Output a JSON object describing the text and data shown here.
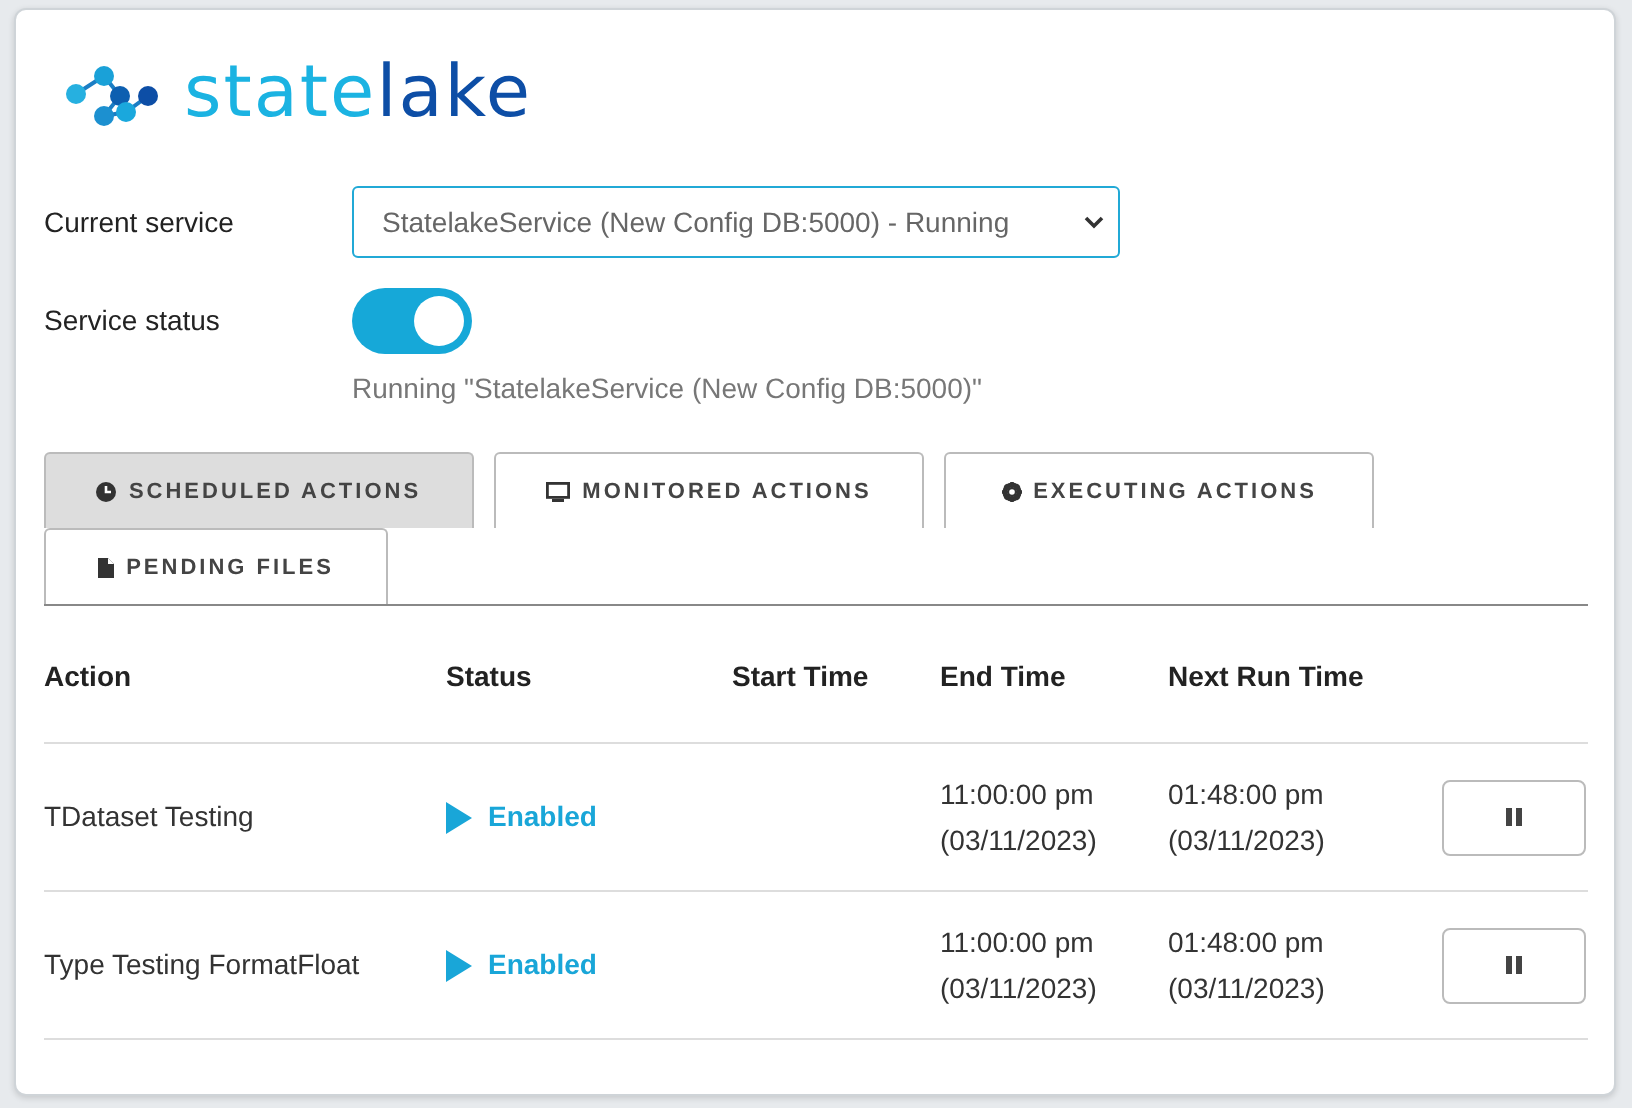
{
  "logo": {
    "parts": [
      {
        "text": "state",
        "color": "#1bb3e2"
      },
      {
        "text": "lake",
        "color": "#0d4ea6"
      }
    ]
  },
  "service": {
    "label": "Current service",
    "value": "StatelakeService (New Config DB:5000) - Running"
  },
  "status": {
    "label": "Service status",
    "on": true,
    "message": "Running \"StatelakeService (New Config DB:5000)\""
  },
  "tabs": [
    {
      "label": "SCHEDULED ACTIONS",
      "selected": true
    },
    {
      "label": "MONITORED ACTIONS",
      "selected": false
    },
    {
      "label": "EXECUTING ACTIONS",
      "selected": false
    },
    {
      "label": "PENDING FILES",
      "selected": false
    }
  ],
  "table": {
    "columns": [
      "Action",
      "Status",
      "Start Time",
      "End Time",
      "Next Run Time"
    ],
    "rows": [
      {
        "action": "TDataset Testing",
        "status": "Enabled",
        "enabled": true,
        "end_time": [
          "11:00:00 pm",
          "(03/11/2023)"
        ],
        "next_run_time": [
          "01:48:00 pm",
          "(03/11/2023)"
        ]
      },
      {
        "action": "Type Testing FormatFloat",
        "status": "Enabled",
        "enabled": true,
        "end_time": [
          "11:00:00 pm",
          "(03/11/2023)"
        ],
        "next_run_time": [
          "01:48:00 pm",
          "(03/11/2023)"
        ]
      }
    ]
  }
}
